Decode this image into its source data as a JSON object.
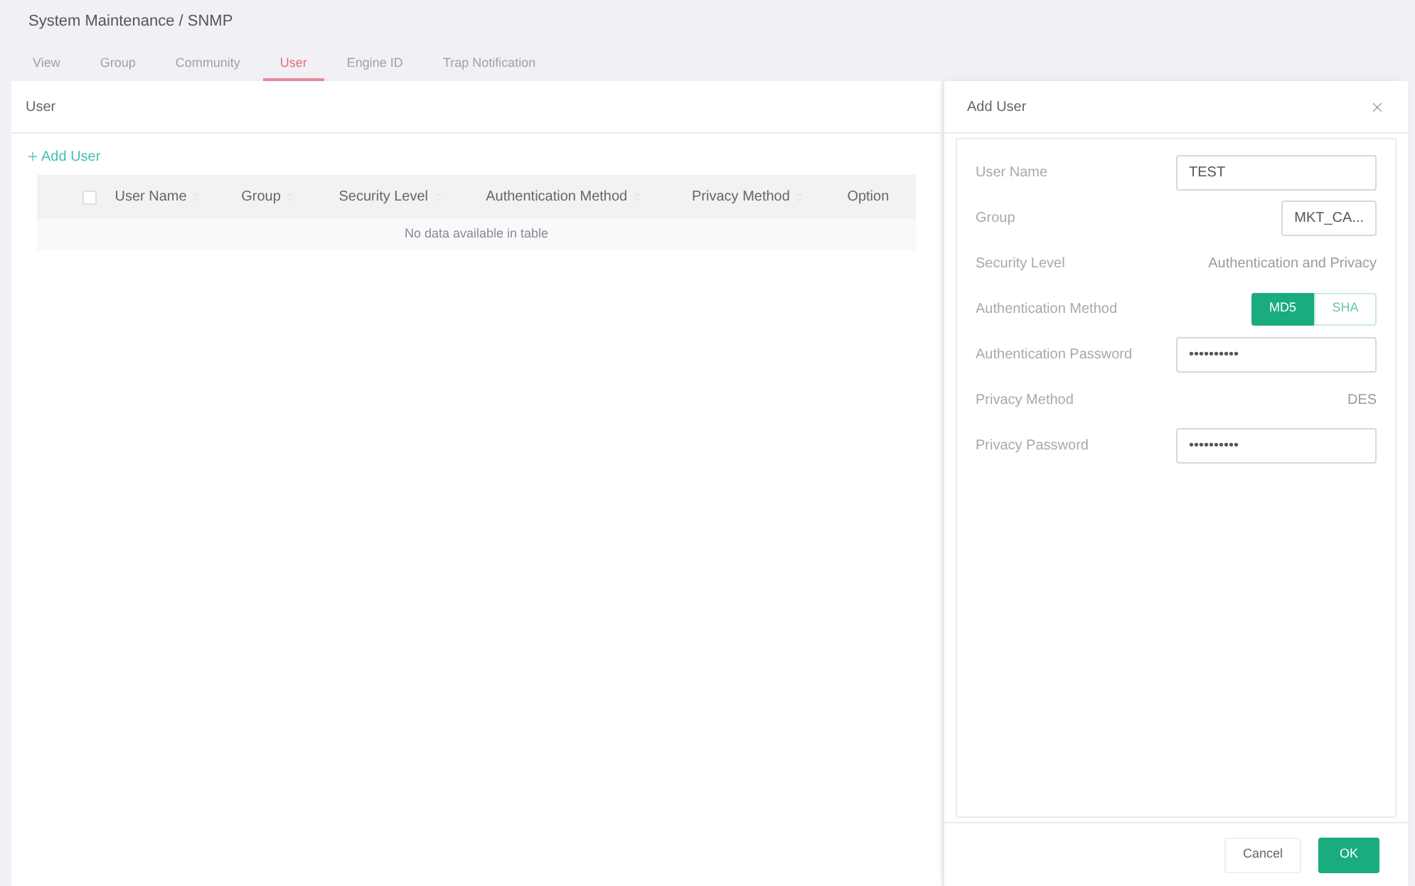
{
  "breadcrumb": "System Maintenance / SNMP",
  "tabs": [
    {
      "label": "View",
      "selected": false
    },
    {
      "label": "Group",
      "selected": false
    },
    {
      "label": "Community",
      "selected": false
    },
    {
      "label": "User",
      "selected": true
    },
    {
      "label": "Engine ID",
      "selected": false
    },
    {
      "label": "Trap Notification",
      "selected": false
    }
  ],
  "panel": {
    "title": "User",
    "add_button": "Add User",
    "table": {
      "select_all_checked": false,
      "columns": [
        {
          "label": "User Name",
          "sortable": true
        },
        {
          "label": "Group",
          "sortable": true
        },
        {
          "label": "Security Level",
          "sortable": true
        },
        {
          "label": "Authentication Method",
          "sortable": true
        },
        {
          "label": "Privacy Method",
          "sortable": true
        },
        {
          "label": "Option",
          "sortable": false
        }
      ],
      "empty_message": "No data available in table"
    }
  },
  "drawer": {
    "title": "Add User",
    "fields": [
      {
        "kind": "input",
        "label": "User Name",
        "value": "TEST"
      },
      {
        "kind": "select",
        "label": "Group",
        "value": "MKT_CA..."
      },
      {
        "kind": "text",
        "label": "Security Level",
        "value": "Authentication and Privacy"
      },
      {
        "kind": "toggle",
        "label": "Authentication Method",
        "options": [
          {
            "label": "MD5",
            "selected": true
          },
          {
            "label": "SHA",
            "selected": false
          }
        ]
      },
      {
        "kind": "input",
        "label": "Authentication Password",
        "value": "••••••••••"
      },
      {
        "kind": "text",
        "label": "Privacy Method",
        "value": "DES"
      },
      {
        "kind": "input",
        "label": "Privacy Password",
        "value": "••••••••••"
      }
    ]
  },
  "buttons": [
    {
      "label": "Cancel",
      "kind": "secondary"
    },
    {
      "label": "OK",
      "kind": "primary"
    }
  ]
}
